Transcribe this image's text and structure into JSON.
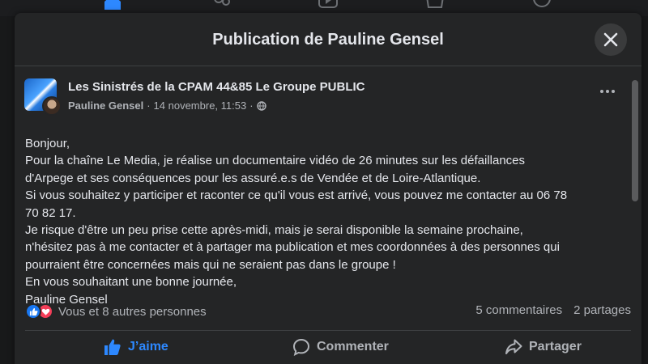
{
  "nav_icons": [
    "home-icon",
    "friends-icon",
    "watch-icon",
    "marketplace-icon",
    "gaming-icon"
  ],
  "modal": {
    "title": "Publication de Pauline Gensel",
    "close_icon": "close-icon"
  },
  "post": {
    "group_name": "Les Sinistrés de la CPAM 44&85 Le Groupe PUBLIC",
    "author": "Pauline Gensel",
    "separator": "·",
    "timestamp": "14 novembre, 11:53",
    "privacy_icon": "globe-icon",
    "lines": [
      "Bonjour,",
      "Pour la chaîne Le Media, je réalise un documentaire vidéo de 26 minutes sur les défaillances",
      "d'Arpege et ses conséquences pour les assuré.e.s de Vendée et de Loire-Atlantique.",
      "Si vous souhaitez y participer et raconter ce qu'il vous est arrivé, vous pouvez me contacter au 06 78",
      "70 82 17.",
      "Je risque d'être un peu prise cette après-midi, mais je serai disponible la semaine prochaine,",
      "n'hésitez pas à me contacter et à partager ma publication et mes coordonnées à des personnes qui",
      "pourraient être concernées mais qui ne seraient pas dans le groupe !",
      "En vous souhaitant une bonne journée,",
      "Pauline Gensel"
    ]
  },
  "stats": {
    "reactions_text": "Vous et 8 autres personnes",
    "comments": "5 commentaires",
    "shares": "2 partages"
  },
  "actions": {
    "like": "J’aime",
    "comment": "Commenter",
    "share": "Partager"
  },
  "colors": {
    "background": "#242526",
    "accent": "#2d88ff",
    "love": "#f33e58",
    "secondary_text": "#b0b3b8"
  }
}
